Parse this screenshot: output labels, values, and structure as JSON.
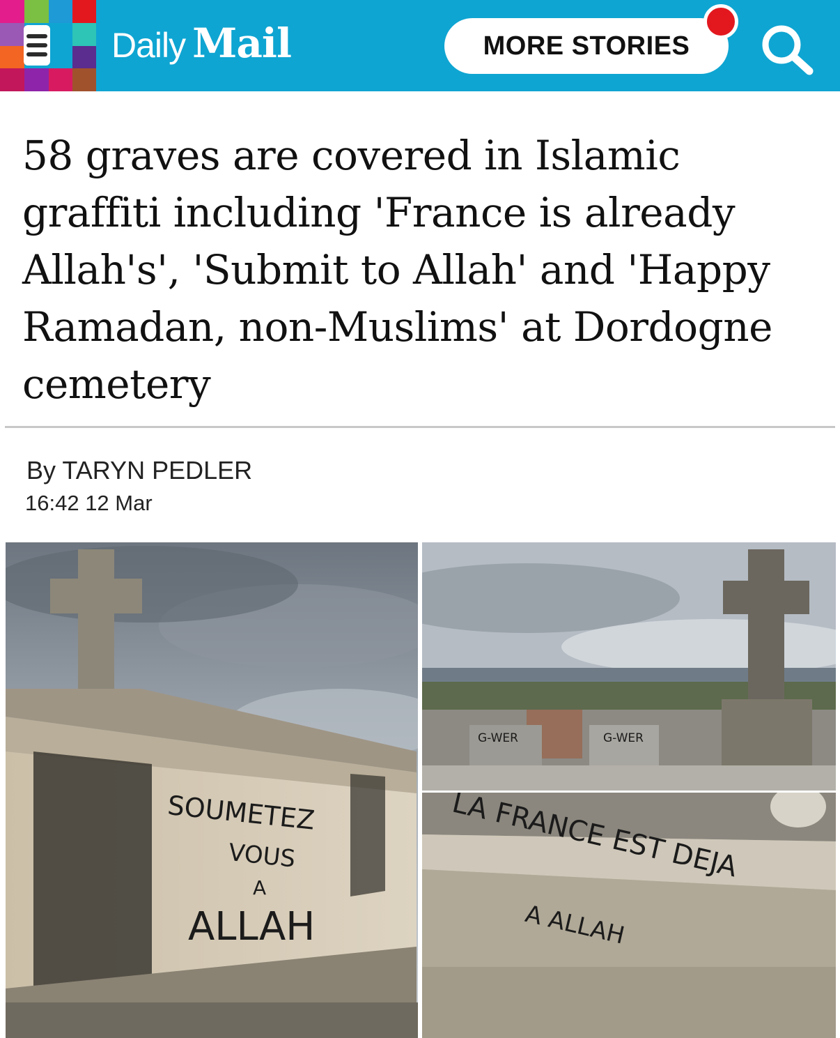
{
  "header": {
    "logo_daily": "Daily",
    "logo_mail": "Mail",
    "more_stories_label": "MORE STORIES",
    "search_icon": "search-icon",
    "menu_icon": "hamburger-menu-icon",
    "notification_color": "#e3181f",
    "background_color": "#0fa5d2"
  },
  "article": {
    "headline": "58 graves are covered in Islamic graffiti including 'France is already Allah's', 'Submit to Allah' and 'Happy Ramadan, non-Muslims' at Dordogne cemetery",
    "byline_prefix": "By",
    "author": "TARYN PEDLER",
    "timestamp": "16:42 12 Mar"
  },
  "photos": {
    "left": {
      "graffiti_line1": "SOUMETEZ",
      "graffiti_line2": "VOUS",
      "graffiti_line3": "A",
      "graffiti_line4": "ALLAH"
    },
    "right_top": {
      "tag1": "G-WER",
      "tag2": "G-WER"
    },
    "right_bottom": {
      "graffiti_line1": "LA FRANCE EST DEJA",
      "graffiti_line2": "A ALLAH"
    }
  }
}
